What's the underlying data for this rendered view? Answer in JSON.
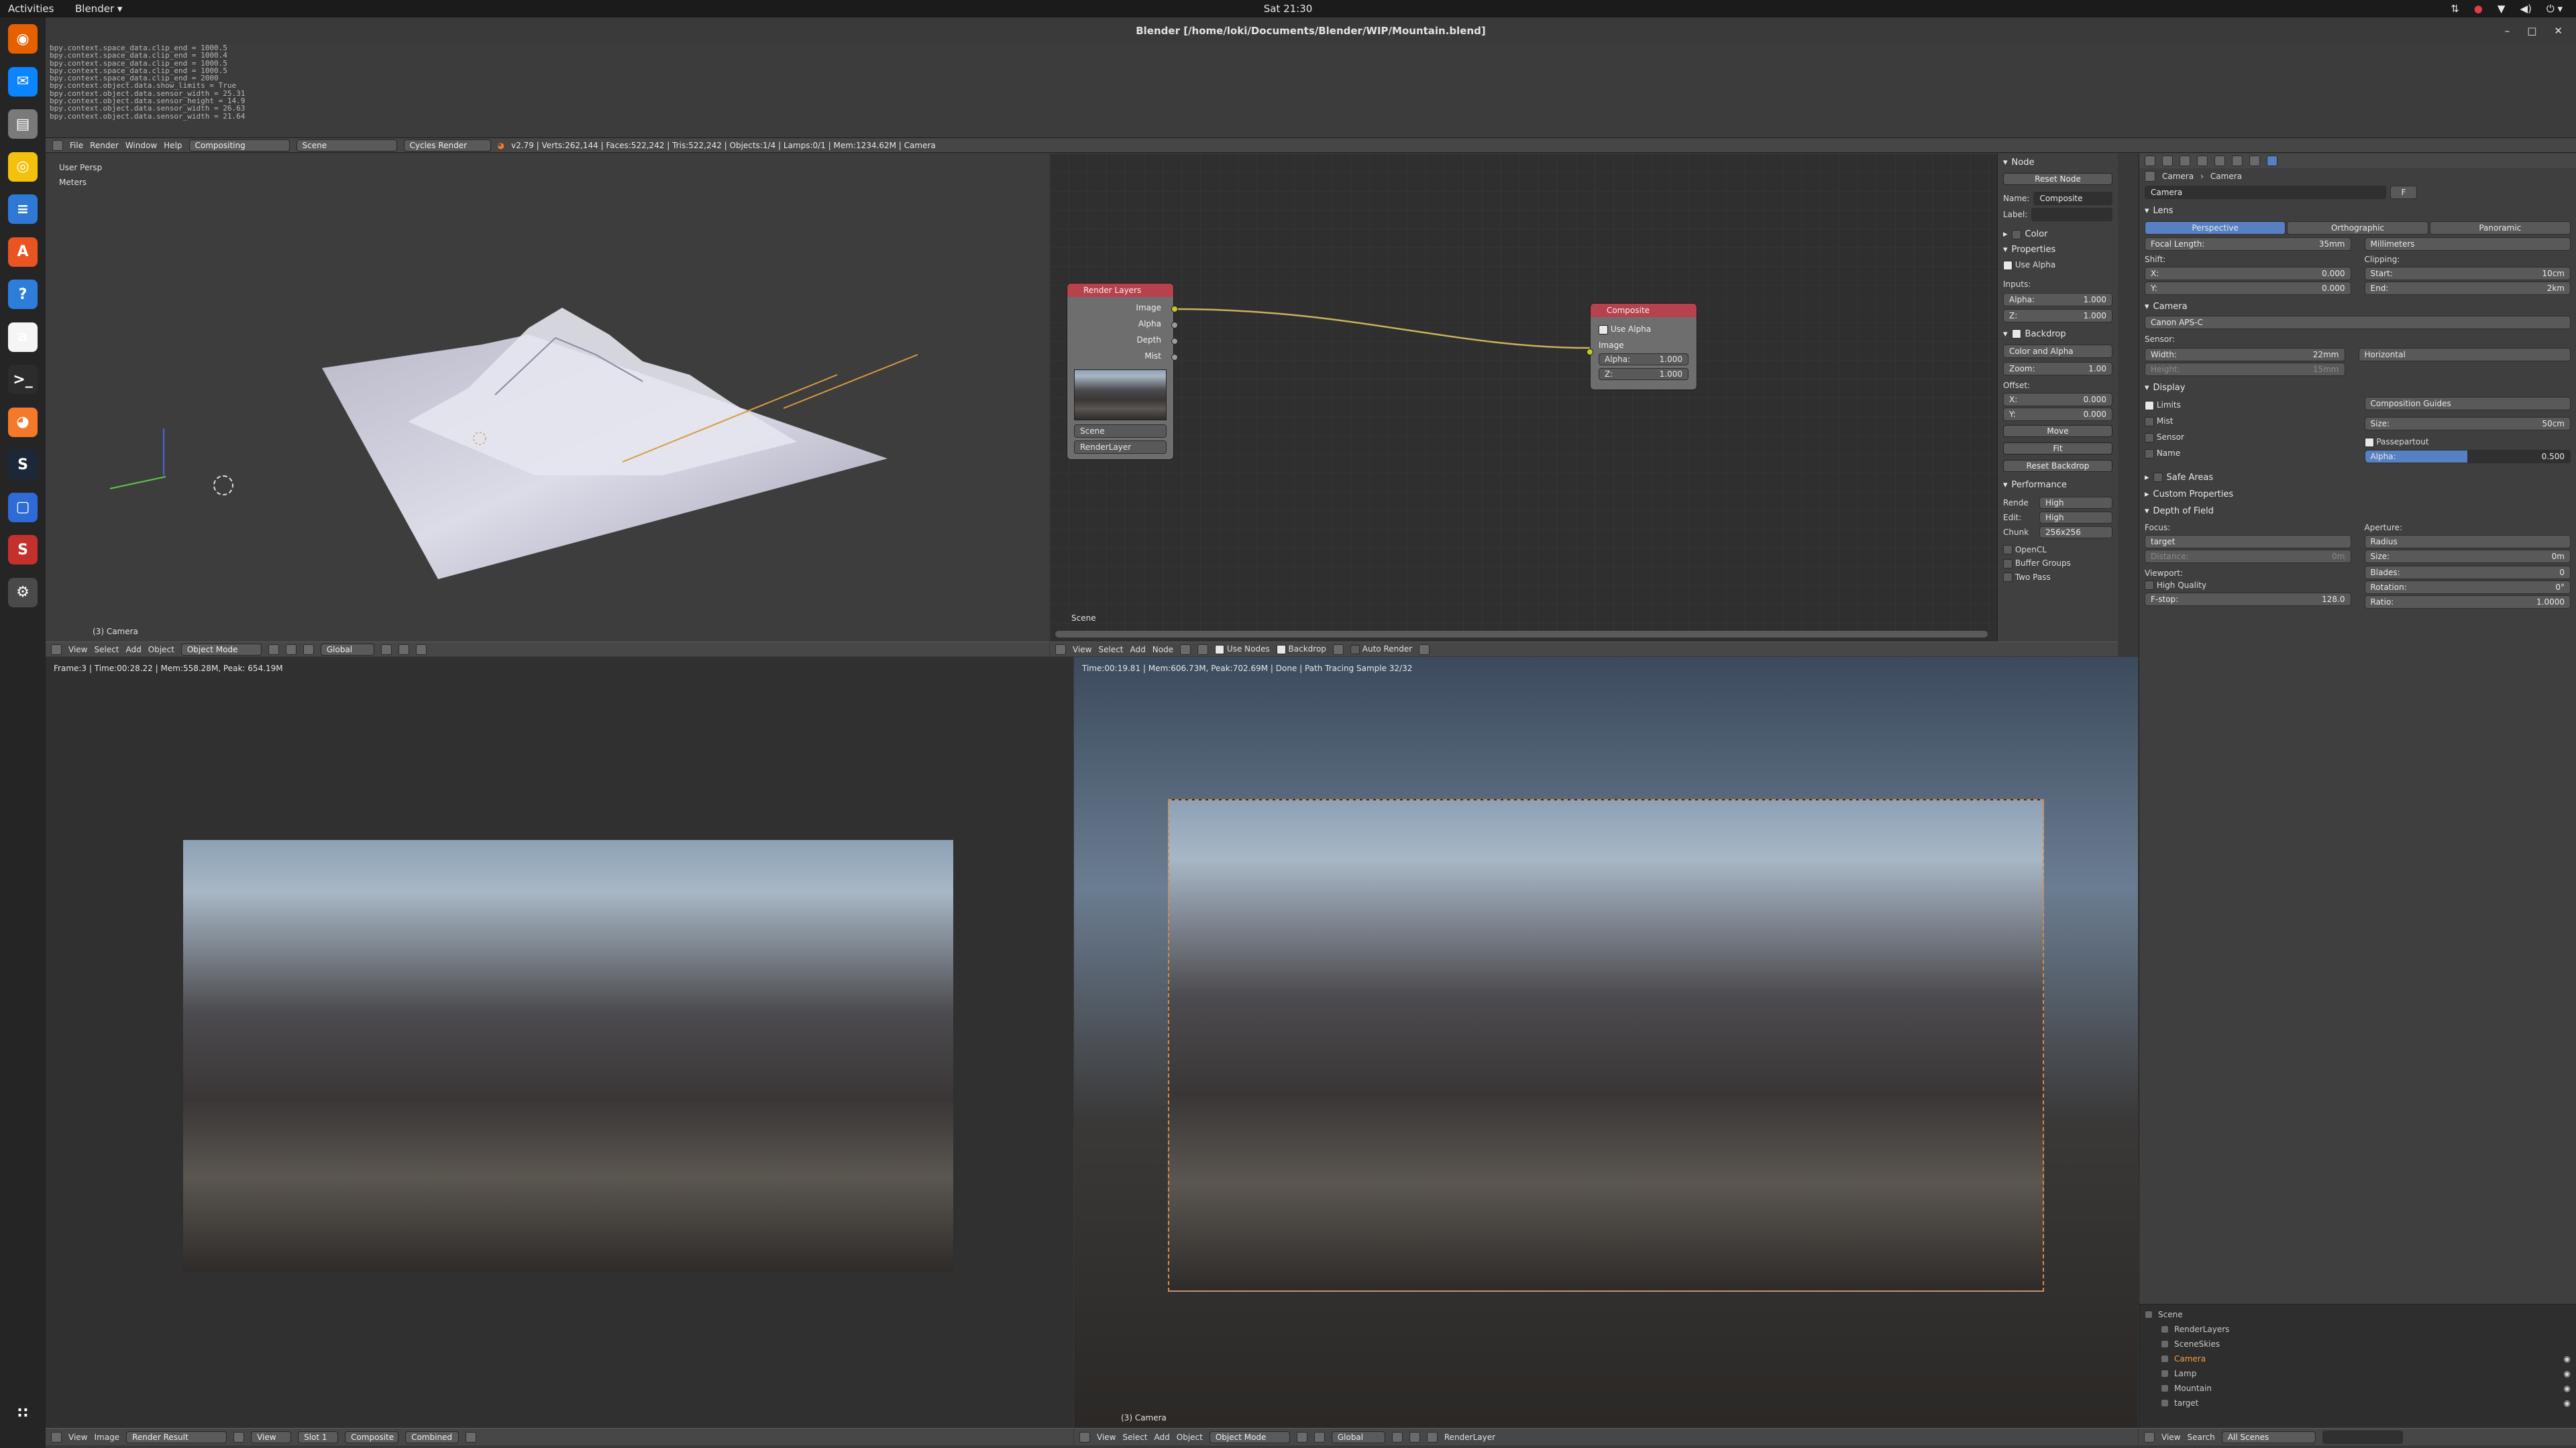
{
  "system": {
    "activities": "Activities",
    "app_menu": "Blender ▾",
    "clock": "Sat 21:30",
    "tray": [
      "⇅",
      "●",
      "▼",
      "◀)",
      "⏻ ▾"
    ]
  },
  "dock": {
    "items": [
      "firefox-icon",
      "thunderbird-icon",
      "files-icon",
      "rhythmbox-icon",
      "writer-icon",
      "software-center-icon",
      "help-icon",
      "amazon-icon",
      "terminal-icon",
      "blender-icon",
      "steam-icon",
      "virtualbox-icon",
      "steam-icon-2",
      "settings-icon",
      "apps-grid-icon"
    ],
    "glyphs": [
      "◉",
      "✉",
      "▤",
      "◎",
      "≡",
      "A",
      "?",
      "a",
      ">_",
      "◕",
      "S",
      "▢",
      "S",
      "⚙",
      "∷"
    ],
    "colors": [
      "#e66000",
      "#0a84ff",
      "#7a7a7a",
      "#f4c20d",
      "#2f79d6",
      "#e95420",
      "#2d7ddb",
      "#f5f5f5",
      "#2c2c2c",
      "#f5792a",
      "#1b2838",
      "#2f6bd6",
      "#c4302b",
      "#4a4a4a",
      "#252525"
    ]
  },
  "window": {
    "title": "Blender [/home/loki/Documents/Blender/WIP/Mountain.blend]",
    "controls": [
      "–",
      "□",
      "✕"
    ]
  },
  "console": {
    "lines": [
      "bpy.context.space_data.clip_end = 1000.5",
      "bpy.context.space_data.clip_end = 1000.4",
      "bpy.context.space_data.clip_end = 1000.5",
      "bpy.context.space_data.clip_end = 1000.5",
      "bpy.context.space_data.clip_end = 2000",
      "bpy.context.object.data.show_limits = True",
      "bpy.context.object.data.sensor_width = 25.31",
      "bpy.context.object.data.sensor_height = 14.9",
      "bpy.context.object.data.sensor_width = 26.63",
      "bpy.context.object.data.sensor_width = 21.64"
    ]
  },
  "infobar": {
    "menus": [
      "File",
      "Render",
      "Window",
      "Help"
    ],
    "screen_layout": "Compositing",
    "scene": "Scene",
    "engine": "Cycles Render",
    "stats": "v2.79 | Verts:262,144 | Faces:522,242 | Tris:522,242 | Objects:1/4 | Lamps:0/1 | Mem:1234.62M | Camera"
  },
  "viewport3d": {
    "view_name": "User Persp",
    "units": "Meters",
    "object_label": "(3) Camera",
    "header": {
      "menus": [
        "View",
        "Select",
        "Add",
        "Object"
      ],
      "mode": "Object Mode",
      "orientation": "Global"
    }
  },
  "node_editor": {
    "render_layers_title": "Render Layers",
    "render_layers_outputs": [
      "Image",
      "Alpha",
      "Depth",
      "Mist"
    ],
    "render_layers_scene": "Scene",
    "render_layers_layer": "RenderLayer",
    "composite_title": "Composite",
    "composite_use_alpha": "Use Alpha",
    "composite_image": "Image",
    "composite_alpha_label": "Alpha:",
    "composite_alpha_value": "1.000",
    "composite_z_label": "Z:",
    "composite_z_value": "1.000",
    "footer_label": "Scene",
    "header": {
      "menus": [
        "View",
        "Select",
        "Add",
        "Node"
      ],
      "use_nodes": "Use Nodes",
      "backdrop": "Backdrop",
      "auto_render": "Auto Render"
    }
  },
  "node_sidebar": {
    "node_header": "Node",
    "reset_node": "Reset Node",
    "name_label": "Name:",
    "name_value": "Composite",
    "label_label": "Label:",
    "color_header": "Color",
    "properties_header": "Properties",
    "use_alpha": "Use Alpha",
    "inputs_label": "Inputs:",
    "alpha_label": "Alpha:",
    "alpha_value": "1.000",
    "z_label": "Z:",
    "z_value": "1.000",
    "backdrop_header": "Backdrop",
    "backdrop_channels": "Color and Alpha",
    "zoom_label": "Zoom:",
    "zoom_value": "1.00",
    "offset_label": "Offset:",
    "x_label": "X:",
    "x_value": "0.000",
    "y_label": "Y:",
    "y_value": "0.000",
    "move": "Move",
    "fit": "Fit",
    "reset_backdrop": "Reset Backdrop",
    "performance_header": "Performance",
    "render_label": "Rende",
    "render_value": "High",
    "edit_label": "Edit:",
    "edit_value": "High",
    "chunk_label": "Chunk",
    "chunk_value": "256x256",
    "opencl": "OpenCL",
    "buffer_groups": "Buffer Groups",
    "two_pass": "Two Pass"
  },
  "properties": {
    "breadcrumb_object": "Camera",
    "breadcrumb_data": "Camera",
    "datablock": "Camera",
    "fake_user": "F",
    "lens_header": "Lens",
    "lens_types": [
      "Perspective",
      "Orthographic",
      "Panoramic"
    ],
    "focal_label": "Focal Length:",
    "focal_value": "35mm",
    "lens_unit": "Millimeters",
    "shift_label": "Shift:",
    "shift_x_label": "X:",
    "shift_x": "0.000",
    "shift_y_label": "Y:",
    "shift_y": "0.000",
    "clipping_label": "Clipping:",
    "clip_start_label": "Start:",
    "clip_start": "10cm",
    "clip_end_label": "End:",
    "clip_end": "2km",
    "camera_header": "Camera",
    "camera_preset": "Canon APS-C",
    "sensor_label": "Sensor:",
    "width_label": "Width:",
    "width_value": "22mm",
    "height_label": "Height:",
    "height_value": "15mm",
    "sensor_fit": "Horizontal",
    "display_header": "Display",
    "limits": "Limits",
    "mist": "Mist",
    "sensor": "Sensor",
    "name": "Name",
    "guides": "Composition Guides",
    "size_label": "Size:",
    "size_value": "50cm",
    "passepartout": "Passepartout",
    "pp_alpha_label": "Alpha:",
    "pp_alpha_value": "0.500",
    "pp_alpha_fraction": 0.5,
    "safe_areas": "Safe Areas",
    "custom_props": "Custom Properties",
    "dof_header": "Depth of Field",
    "focus_label": "Focus:",
    "focus_object": "target",
    "distance_label": "Distance:",
    "distance_value": "0m",
    "aperture_label": "Aperture:",
    "aperture_type": "Radius",
    "ap_size_label": "Size:",
    "ap_size_value": "0m",
    "blades_label": "Blades:",
    "blades_value": "0",
    "rotation_label": "Rotation:",
    "rotation_value": "0°",
    "ratio_label": "Ratio:",
    "ratio_value": "1.0000",
    "viewport_label": "Viewport:",
    "high_quality": "High Quality",
    "fstop_label": "F-stop:",
    "fstop_value": "128.0"
  },
  "image_editor": {
    "status": "Frame:3 | Time:00:28.22 | Mem:558.28M, Peak: 654.19M",
    "header": {
      "menus": [
        "View",
        "Image"
      ],
      "image": "Render Result",
      "view": "View",
      "slot": "Slot 1",
      "layer": "Composite",
      "pass": "Combined"
    }
  },
  "render_view": {
    "status": "Time:00:19.81 | Mem:606.73M, Peak:702.69M | Done | Path Tracing Sample 32/32",
    "object_label": "(3) Camera",
    "header": {
      "menus": [
        "View",
        "Select",
        "Add",
        "Object"
      ],
      "mode": "Object Mode",
      "orientation": "Global",
      "layer": "RenderLayer"
    }
  },
  "outliner": {
    "items": [
      {
        "label": "Scene",
        "depth": 0,
        "color": "#c8c8c8"
      },
      {
        "label": "RenderLayers",
        "depth": 1,
        "color": "#c8c8c8"
      },
      {
        "label": "SceneSkies",
        "depth": 1,
        "color": "#c8c8c8"
      },
      {
        "label": "Camera",
        "depth": 1,
        "color": "#f0a040"
      },
      {
        "label": "Lamp",
        "depth": 1,
        "color": "#c8c8c8"
      },
      {
        "label": "Mountain",
        "depth": 1,
        "color": "#c8c8c8"
      },
      {
        "label": "target",
        "depth": 1,
        "color": "#c8c8c8"
      }
    ],
    "footer": {
      "menus": [
        "View",
        "Search"
      ],
      "filter": "All Scenes"
    }
  }
}
